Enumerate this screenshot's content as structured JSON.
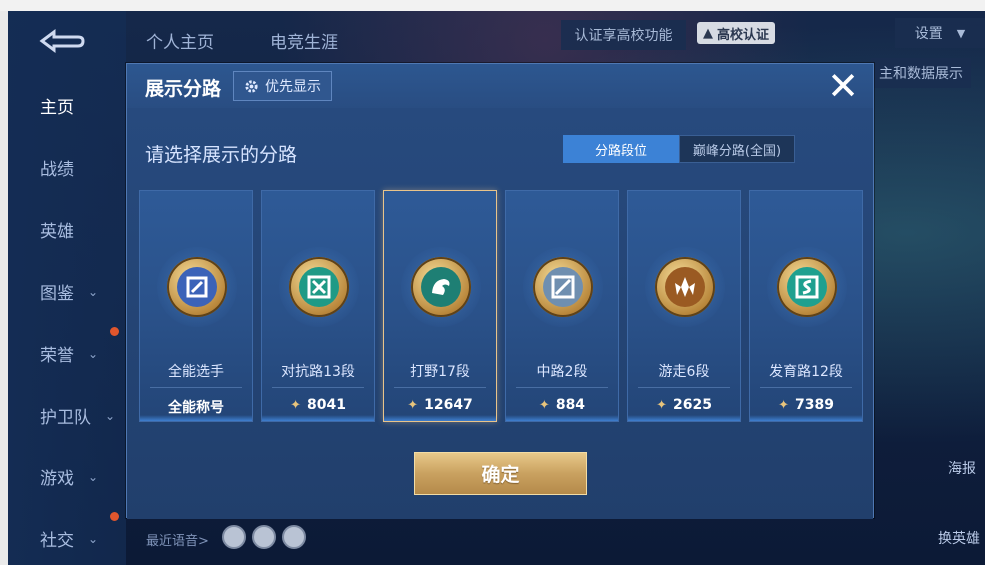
{
  "sidebar": {
    "items": [
      {
        "label": "主页",
        "active": true,
        "chevron": false
      },
      {
        "label": "战绩",
        "active": false,
        "chevron": false
      },
      {
        "label": "英雄",
        "active": false,
        "chevron": false
      },
      {
        "label": "图鉴",
        "active": false,
        "chevron": true
      },
      {
        "label": "荣誉",
        "active": false,
        "chevron": true
      },
      {
        "label": "护卫队",
        "active": false,
        "chevron": true
      },
      {
        "label": "游戏",
        "active": false,
        "chevron": true
      },
      {
        "label": "社交",
        "active": false,
        "chevron": true
      }
    ]
  },
  "top_tabs": {
    "profile": "个人主页",
    "esports": "电竞生涯"
  },
  "top_bar": {
    "school_text": "认证享高校功能",
    "school_badge": "高校认证",
    "settings": "设置",
    "data_display": "主和数据展示"
  },
  "bottom": {
    "recent_voice": "最近语音>",
    "share": "海报",
    "switch_hero": "换英雄"
  },
  "dialog": {
    "title": "展示分路",
    "priority_label": "优先显示",
    "close_icon": "close-icon",
    "prompt": "请选择展示的分路",
    "segments": [
      {
        "label": "分路段位",
        "active": true
      },
      {
        "label": "巅峰分路(全国)",
        "active": false
      }
    ],
    "lanes": [
      {
        "name": "全能选手",
        "score": "全能称号",
        "show_gem": false,
        "selected": false,
        "icon": "all-round-icon"
      },
      {
        "name": "对抗路13段",
        "score": "8041",
        "show_gem": true,
        "selected": false,
        "icon": "clash-lane-icon"
      },
      {
        "name": "打野17段",
        "score": "12647",
        "show_gem": true,
        "selected": true,
        "icon": "jungle-icon"
      },
      {
        "name": "中路2段",
        "score": "884",
        "show_gem": true,
        "selected": false,
        "icon": "mid-lane-icon"
      },
      {
        "name": "游走6段",
        "score": "2625",
        "show_gem": true,
        "selected": false,
        "icon": "roam-icon"
      },
      {
        "name": "发育路12段",
        "score": "7389",
        "show_gem": true,
        "selected": false,
        "icon": "farm-lane-icon"
      }
    ],
    "confirm_label": "确定"
  },
  "colors": {
    "accent": "#3c82d6",
    "gold": "#e8c47c",
    "selected_border": "#e9c48a",
    "panel": "#274a7e"
  }
}
